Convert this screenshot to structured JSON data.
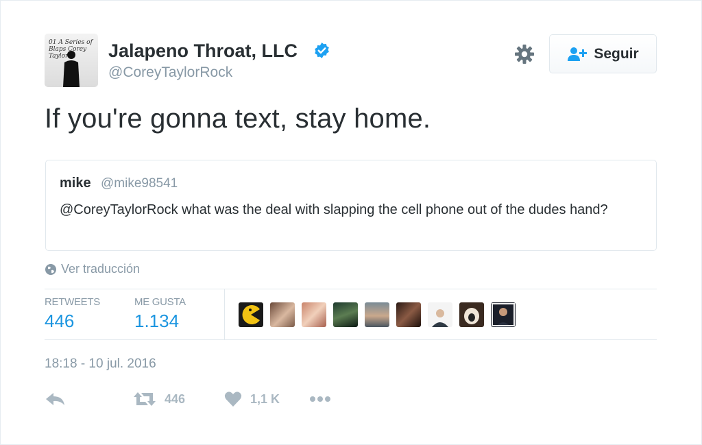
{
  "account": {
    "name": "Jalapeno Throat, LLC",
    "handle": "@CoreyTaylorRock",
    "avatar_text": "01 A Series of Blaps Corey Taylor"
  },
  "follow": {
    "label": "Seguir"
  },
  "tweet": {
    "text": "If you're gonna text, stay home."
  },
  "quoted": {
    "name": "mike",
    "handle": "@mike98541",
    "text": "@CoreyTaylorRock what was the deal with slapping the cell phone out of the dudes hand?"
  },
  "translate": {
    "label": "Ver traducción"
  },
  "stats": {
    "retweets_label": "RETWEETS",
    "retweets_value": "446",
    "likes_label": "ME GUSTA",
    "likes_value": "1.134"
  },
  "favoriters": [
    {
      "icon": "pacman-avatar"
    },
    {
      "icon": "woman-avatar"
    },
    {
      "icon": "woman-avatar"
    },
    {
      "icon": "landscape-avatar"
    },
    {
      "icon": "man-avatar"
    },
    {
      "icon": "woman-avatar"
    },
    {
      "icon": "man-avatar"
    },
    {
      "icon": "dog-avatar"
    },
    {
      "icon": "man-avatar"
    }
  ],
  "timestamp": "18:18 - 10 jul. 2016",
  "actions": {
    "retweet_count": "446",
    "like_count": "1,1 K"
  },
  "colors": {
    "link": "#1b95e0",
    "muted": "#8899a6",
    "verified": "#1da1f2",
    "action": "#aab8c2"
  }
}
